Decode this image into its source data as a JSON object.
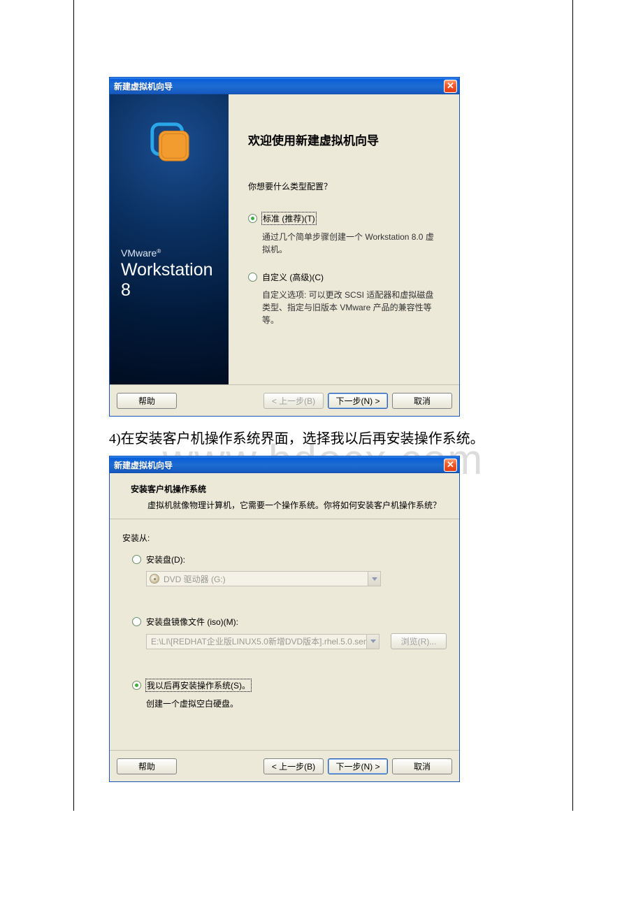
{
  "watermark": "www.bdocx.com",
  "dialog1": {
    "title": "新建虚拟机向导",
    "close": "✕",
    "brandTop": "VMware",
    "brandSup": "®",
    "brandProduct": "Workstation 8",
    "welcome": "欢迎使用新建虚拟机向导",
    "question": "你想要什么类型配置？",
    "opt1": {
      "label": "标准 (推荐)(T)",
      "desc": "通过几个简单步骤创建一个 Workstation 8.0 虚拟机。"
    },
    "opt2": {
      "label": "自定义 (高级)(C)",
      "desc": "自定义选项: 可以更改 SCSI 适配器和虚拟磁盘类型、指定与旧版本 VMware 产品的兼容性等等。"
    },
    "buttons": {
      "help": "帮助",
      "back": "< 上一步(B)",
      "next": "下一步(N) >",
      "cancel": "取消"
    }
  },
  "stepText": "4)在安装客户机操作系统界面，选择我以后再安装操作系统。",
  "dialog2": {
    "title": "新建虚拟机向导",
    "close": "✕",
    "headTitle": "安装客户机操作系统",
    "headSub": "虚拟机就像物理计算机，它需要一个操作系统。你将如何安装客户机操作系统？",
    "installFrom": "安装从:",
    "optDisc": {
      "label": "安装盘(D):",
      "combo": "DVD 驱动器 (G:)"
    },
    "optIso": {
      "label": "安装盘镜像文件 (iso)(M):",
      "combo": "E:\\LI\\[REDHAT企业版LINUX5.0新增DVD版本].rhel.5.0.ser",
      "browse": "浏览(R)..."
    },
    "optLater": {
      "label": "我以后再安装操作系统(S)。",
      "desc": "创建一个虚拟空白硬盘。"
    },
    "buttons": {
      "help": "帮助",
      "back": "< 上一步(B)",
      "next": "下一步(N) >",
      "cancel": "取消"
    }
  }
}
